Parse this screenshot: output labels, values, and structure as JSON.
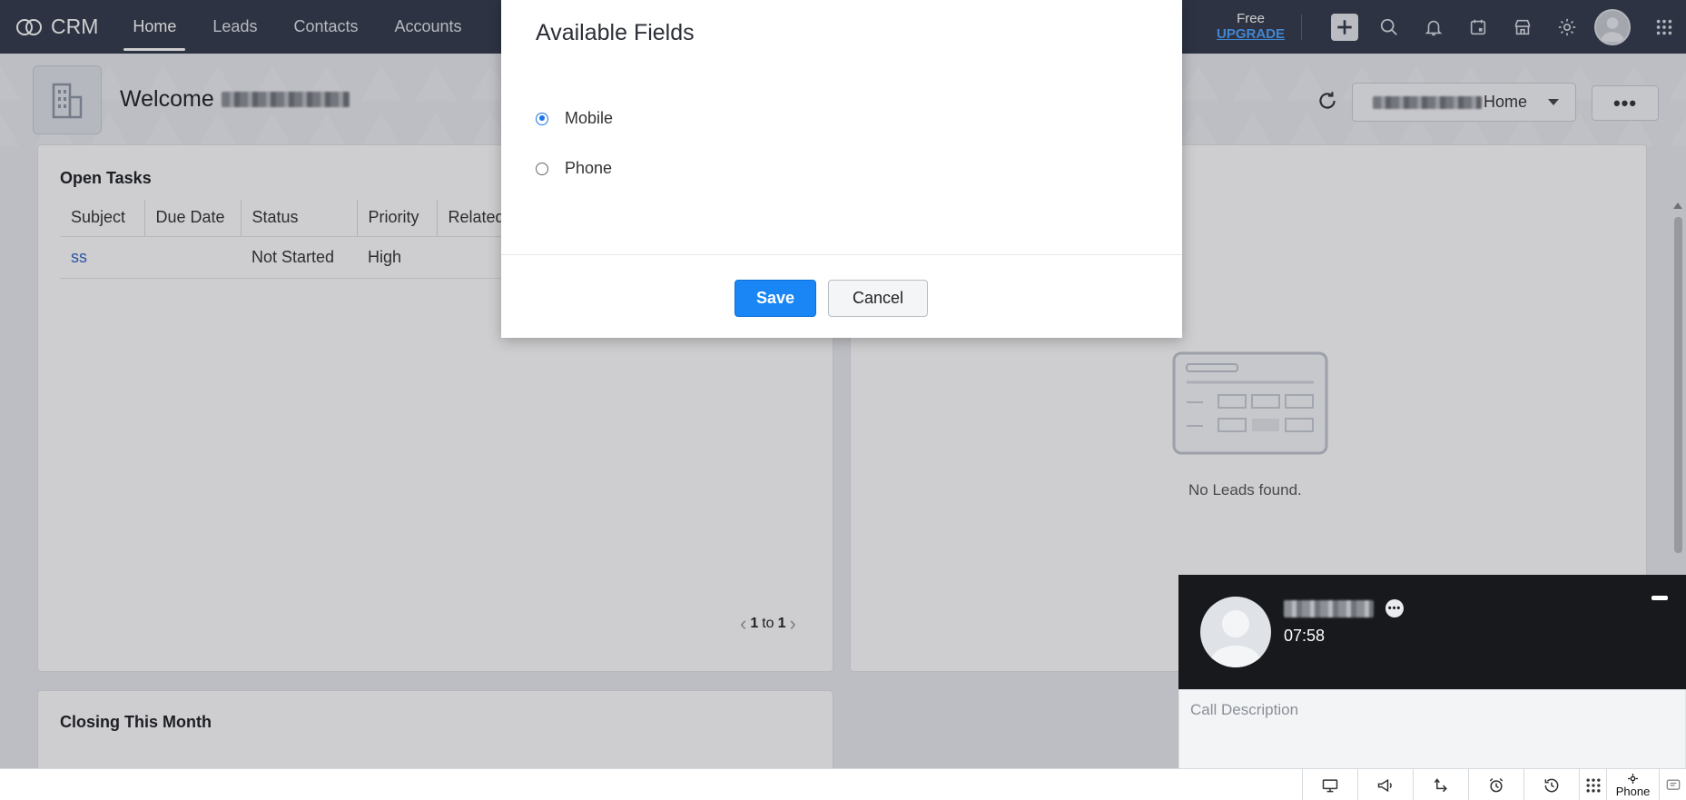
{
  "topnav": {
    "brand": "CRM",
    "tabs": [
      "Home",
      "Leads",
      "Contacts",
      "Accounts"
    ],
    "plan_label": "Free",
    "upgrade_label": "UPGRADE"
  },
  "header": {
    "welcome": "Welcome",
    "view_select": "Home",
    "more": "•••"
  },
  "open_tasks": {
    "title": "Open Tasks",
    "columns": [
      "Subject",
      "Due Date",
      "Status",
      "Priority",
      "Related"
    ],
    "rows": [
      {
        "subject": "ss",
        "due_date": "",
        "status": "Not Started",
        "priority": "High",
        "related": ""
      }
    ],
    "pager": {
      "start": "1",
      "sep": "to",
      "end": "1"
    }
  },
  "leads_card": {
    "empty_text": "No Leads found."
  },
  "closing": {
    "title": "Closing This Month"
  },
  "modal": {
    "title": "Available Fields",
    "options": [
      {
        "label": "Mobile",
        "selected": true
      },
      {
        "label": "Phone",
        "selected": false
      }
    ],
    "save_label": "Save",
    "cancel_label": "Cancel"
  },
  "call_widget": {
    "timer": "07:58",
    "description_placeholder": "Call Description"
  },
  "bottombar": {
    "phone_label": "Phone"
  },
  "colors": {
    "nav_bg": "#313949",
    "primary": "#1a86f5",
    "link": "#2b66c7",
    "call_bg": "#17191c"
  }
}
